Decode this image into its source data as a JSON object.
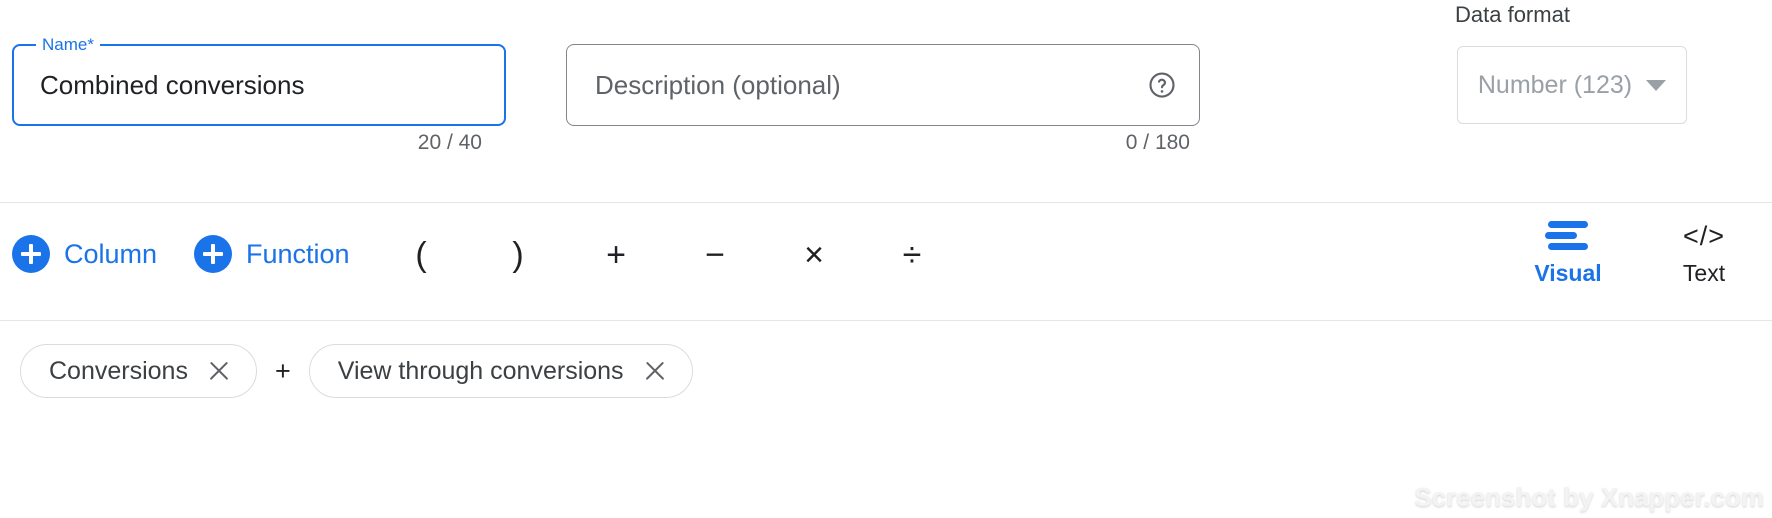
{
  "fields": {
    "name": {
      "label": "Name*",
      "value": "Combined conversions",
      "counter": "20 / 40"
    },
    "description": {
      "placeholder": "Description (optional)",
      "value": "",
      "counter": "0 / 180",
      "help_icon": "help-circle-icon"
    },
    "data_format": {
      "label": "Data format",
      "selected": "Number (123)",
      "caret_icon": "chevron-down-icon"
    }
  },
  "toolbar": {
    "add_column": {
      "label": "Column",
      "icon": "plus-circle-icon"
    },
    "add_function": {
      "label": "Function",
      "icon": "plus-circle-icon"
    },
    "operators": [
      {
        "name": "paren-open",
        "symbol": "("
      },
      {
        "name": "paren-close",
        "symbol": ")"
      },
      {
        "name": "plus",
        "symbol": "+"
      },
      {
        "name": "minus",
        "symbol": "−"
      },
      {
        "name": "multiply",
        "symbol": "×"
      },
      {
        "name": "divide",
        "symbol": "÷"
      }
    ],
    "views": {
      "visual": {
        "label": "Visual",
        "icon": "align-bars-icon",
        "active": true
      },
      "text": {
        "label": "Text",
        "icon": "code-brackets-icon",
        "active": false
      }
    }
  },
  "formula": {
    "chips": [
      {
        "label": "Conversions",
        "close_icon": "close-icon"
      },
      {
        "label": "View through conversions",
        "close_icon": "close-icon"
      }
    ],
    "operator_between": "+"
  },
  "watermark": "Screenshot by Xnapper.com",
  "colors": {
    "accent_blue": "#1a73e8",
    "text_primary": "#202124",
    "text_secondary": "#5f6368",
    "border_light": "#dadce0",
    "border_medium": "#80868b"
  }
}
